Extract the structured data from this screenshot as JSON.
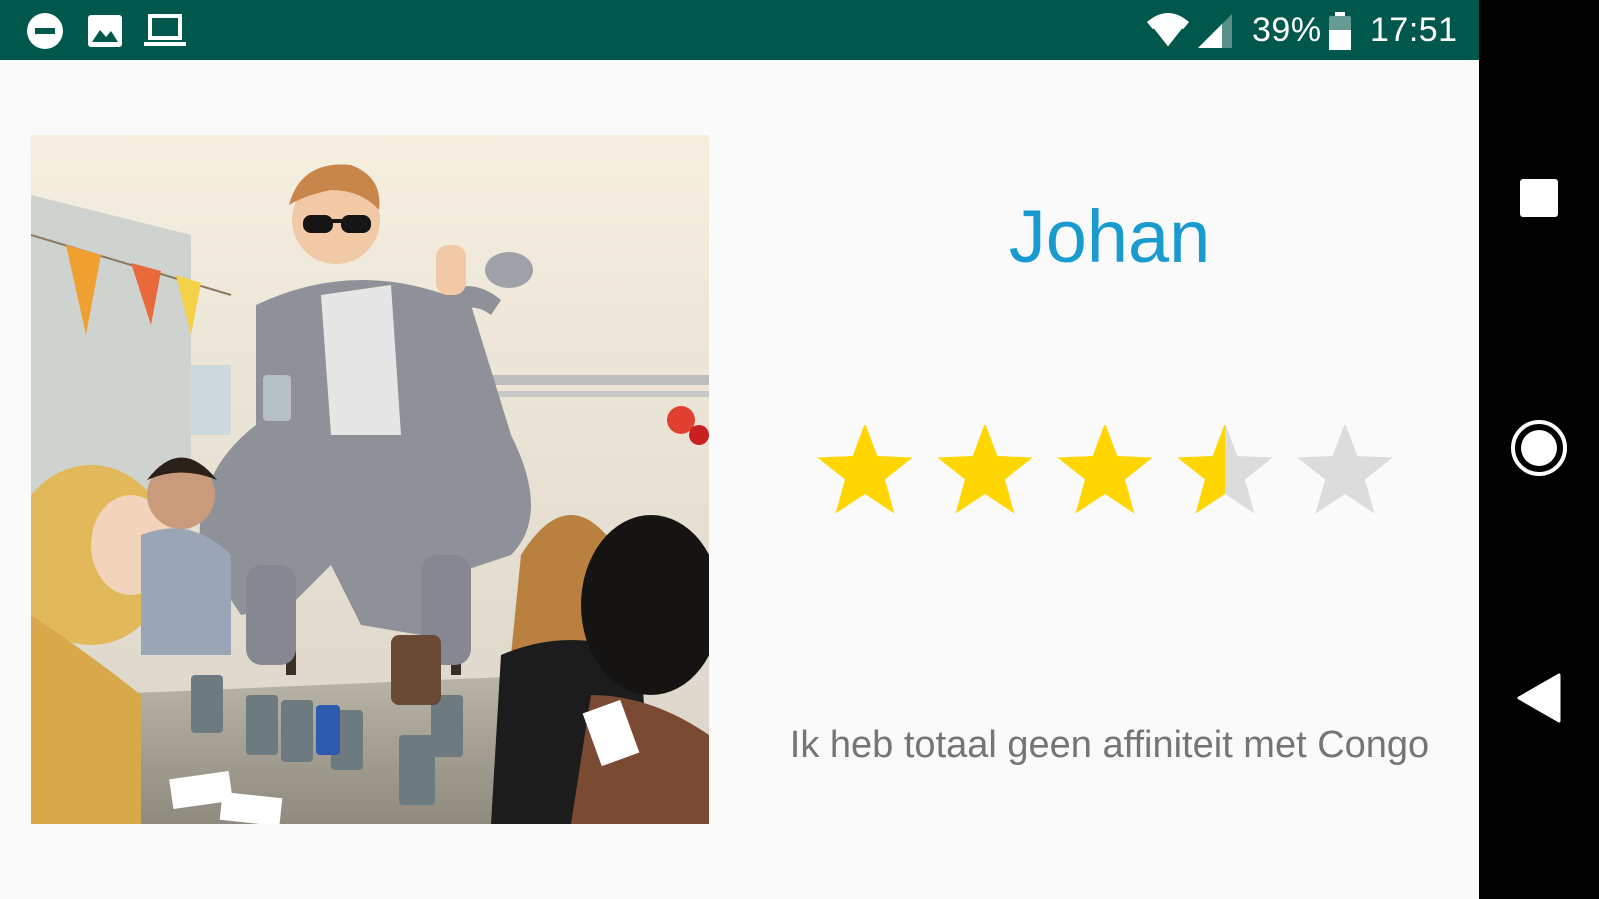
{
  "status_bar": {
    "left_icons": [
      "dnd-icon",
      "image-icon",
      "laptop-icon"
    ],
    "wifi_icon": "wifi-icon",
    "signal_icon": "signal-icon",
    "battery_percent": "39%",
    "battery_icon": "battery-icon",
    "time": "17:51",
    "background": "#00574b"
  },
  "profile": {
    "photo_alt": "Profielfoto",
    "name": "Johan",
    "rating": 3.5,
    "rating_max": 5,
    "caption": "Ik heb totaal geen affiniteit met Congo"
  },
  "nav_bar": {
    "items": [
      "recents-square-icon",
      "home-circle-icon",
      "back-triangle-icon"
    ]
  },
  "colors": {
    "name_color": "#1a9bd0",
    "star_filled": "#ffd600",
    "star_empty": "#dcdcdc",
    "caption_color": "#757575"
  }
}
